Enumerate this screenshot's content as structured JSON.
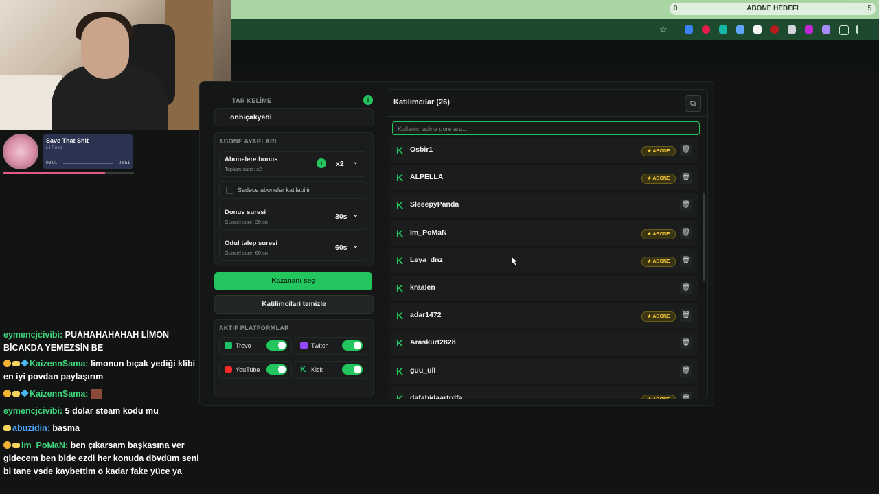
{
  "browser": {
    "goal_left": "0",
    "goal_title": "ABONE HEDEFI",
    "goal_dash": "—",
    "goal_right": "5"
  },
  "music": {
    "title": "Save That Shit",
    "artist": "Lil Peep",
    "elapsed": "03:01",
    "total": "03:51",
    "progress": 0.78
  },
  "chat": [
    {
      "user": "eymencjcivibi:",
      "text": "PUAHAHAHAHAH LİMON BİCAKDA YEMEZSİN BE",
      "color": "green"
    },
    {
      "user": "KaizennSama:",
      "text": "limonun bıçak yediği klibi en iyi povdan paylaşırım",
      "color": "green"
    },
    {
      "user": "KaizennSama:",
      "text": "",
      "color": "green"
    },
    {
      "user": "eymencjcivibi:",
      "text": "5 dolar steam kodu mu",
      "color": "green"
    },
    {
      "user": "abuzidin:",
      "text": "basma",
      "color": "blue"
    },
    {
      "user": "Im_PoMaN:",
      "text": "ben çıkarsam başkasına ver gidecem ben bide ezdi her konuda dövdüm seni bi tane vsde kaybettim o kadar fake yüce ya",
      "color": "green"
    }
  ],
  "left": {
    "keyword_section": "TAR KELİME",
    "keyword_value": "onbıçakyedi",
    "sub_section": "ABONE AYARLARI",
    "bonus_label": "Abonelere bonus",
    "bonus_sub": "Toplam sans: x2",
    "bonus_value": "x2",
    "only_subs_label": "Sadece aboneler katilabilir",
    "bonus_time_label": "Donus suresi",
    "bonus_time_sub": "Guncel sure: 30 sn",
    "bonus_time_value": "30s",
    "claim_label": "Odul talep suresi",
    "claim_sub": "Guncel sure: 60 sn",
    "claim_value": "60s",
    "pick_button": "Kazananı seç",
    "clear_button": "Katilimcilari temizle",
    "platform_section": "AKTİF PLATFORMLAR",
    "platforms": [
      {
        "name": "Trovo",
        "color": "#1fbf6a"
      },
      {
        "name": "Twitch",
        "color": "#9146ff"
      },
      {
        "name": "YouTube",
        "color": "#ff2a2a"
      },
      {
        "name": "Kick",
        "color": "#22c55e"
      }
    ]
  },
  "participants": {
    "title": "Katilimcilar (26)",
    "search_placeholder": "Kullanici adina gore ara...",
    "abone_label": "★ ABONE",
    "rows": [
      {
        "name": "Osbir1",
        "abone": true
      },
      {
        "name": "ALPELLA",
        "abone": true
      },
      {
        "name": "SleeepyPanda",
        "abone": false
      },
      {
        "name": "Im_PoMaN",
        "abone": true
      },
      {
        "name": "Leya_dnz",
        "abone": true
      },
      {
        "name": "kraalen",
        "abone": false
      },
      {
        "name": "adar1472",
        "abone": true
      },
      {
        "name": "Araskurt2828",
        "abone": false
      },
      {
        "name": "guu_ull",
        "abone": false
      },
      {
        "name": "dafahidaartrdfa",
        "abone": true
      }
    ]
  }
}
